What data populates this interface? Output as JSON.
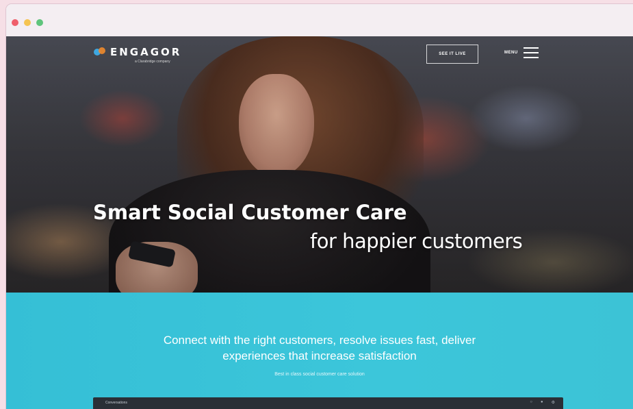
{
  "window": {
    "controls": [
      "close",
      "minimize",
      "maximize"
    ]
  },
  "header": {
    "logo_text": "ENGAGOR",
    "logo_subtext": "a Clarabridge company",
    "cta_label": "SEE IT LIVE",
    "menu_label": "MENU"
  },
  "hero": {
    "headline": "Smart Social Customer Care",
    "subheadline": "for happier customers"
  },
  "intro": {
    "tagline_line1": "Connect with the right customers, resolve issues fast, deliver",
    "tagline_line2": "experiences that increase satisfaction",
    "caption": "Best in class social customer care solution"
  },
  "dashboard": {
    "title": "Conversations"
  },
  "colors": {
    "teal": "#3cc6da",
    "logo_blue": "#3ea7e0",
    "logo_orange": "#f08a2c"
  }
}
